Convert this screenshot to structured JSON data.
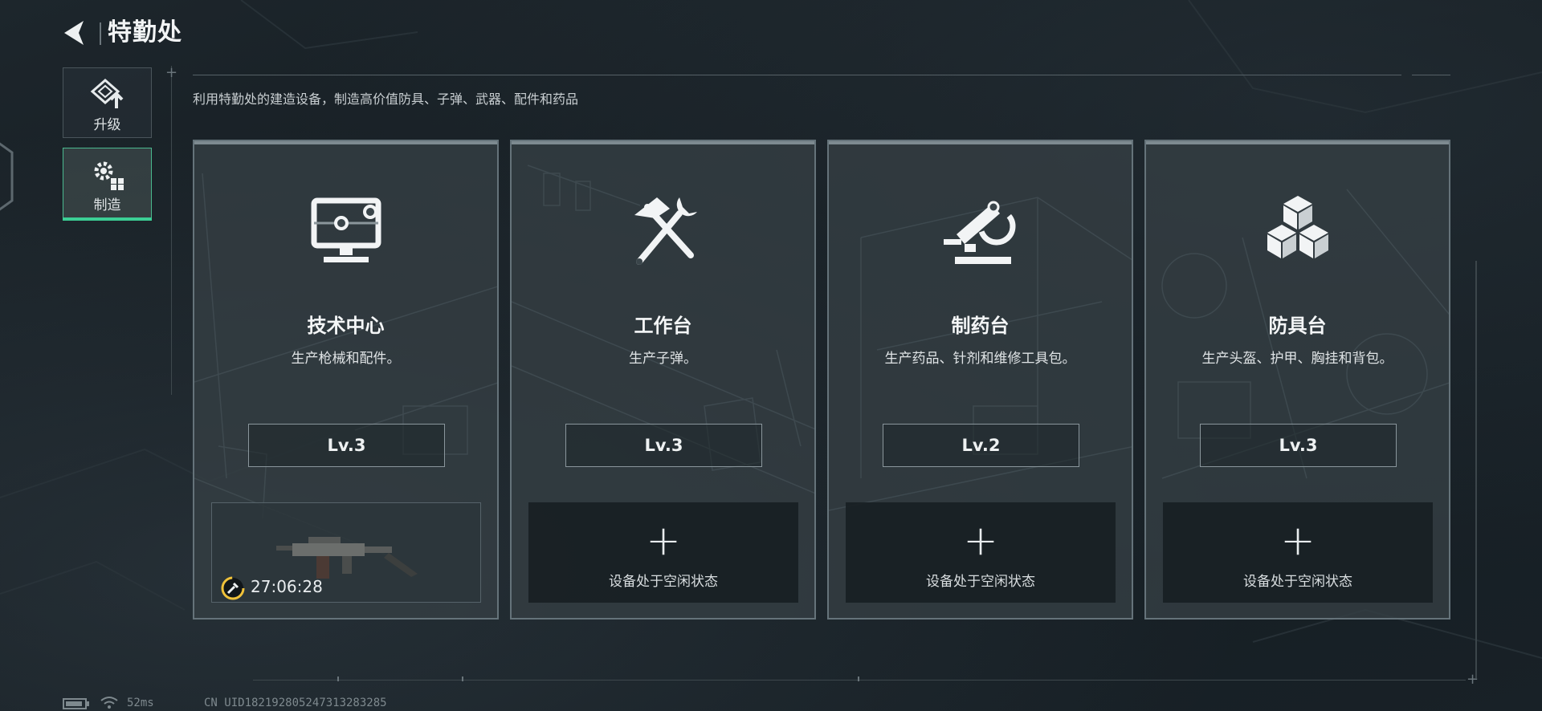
{
  "header": {
    "title": "特勤处"
  },
  "nav": [
    {
      "label": "升级",
      "icon": "upgrade-icon",
      "active": false
    },
    {
      "label": "制造",
      "icon": "gear-build-icon",
      "active": true
    }
  ],
  "subtitle": "利用特勤处的建造设备，制造高价值防具、子弹、武器、配件和药品",
  "cards": [
    {
      "name": "技术中心",
      "desc": "生产枪械和配件。",
      "level": "Lv.3",
      "icon": "monitor-icon",
      "slot": {
        "state": "busy",
        "timer": "27:06:28"
      }
    },
    {
      "name": "工作台",
      "desc": "生产子弹。",
      "level": "Lv.3",
      "icon": "hammer-wrench-icon",
      "slot": {
        "state": "idle",
        "plus": "+",
        "text": "设备处于空闲状态"
      }
    },
    {
      "name": "制药台",
      "desc": "生产药品、针剂和维修工具包。",
      "level": "Lv.2",
      "icon": "microscope-icon",
      "slot": {
        "state": "idle",
        "plus": "+",
        "text": "设备处于空闲状态"
      }
    },
    {
      "name": "防具台",
      "desc": "生产头盔、护甲、胸挂和背包。",
      "level": "Lv.3",
      "icon": "cubes-icon",
      "slot": {
        "state": "idle",
        "plus": "+",
        "text": "设备处于空闲状态"
      }
    }
  ],
  "status_bar": {
    "ping": "52ms",
    "uid": "CN UID18219280524731328328​5"
  }
}
